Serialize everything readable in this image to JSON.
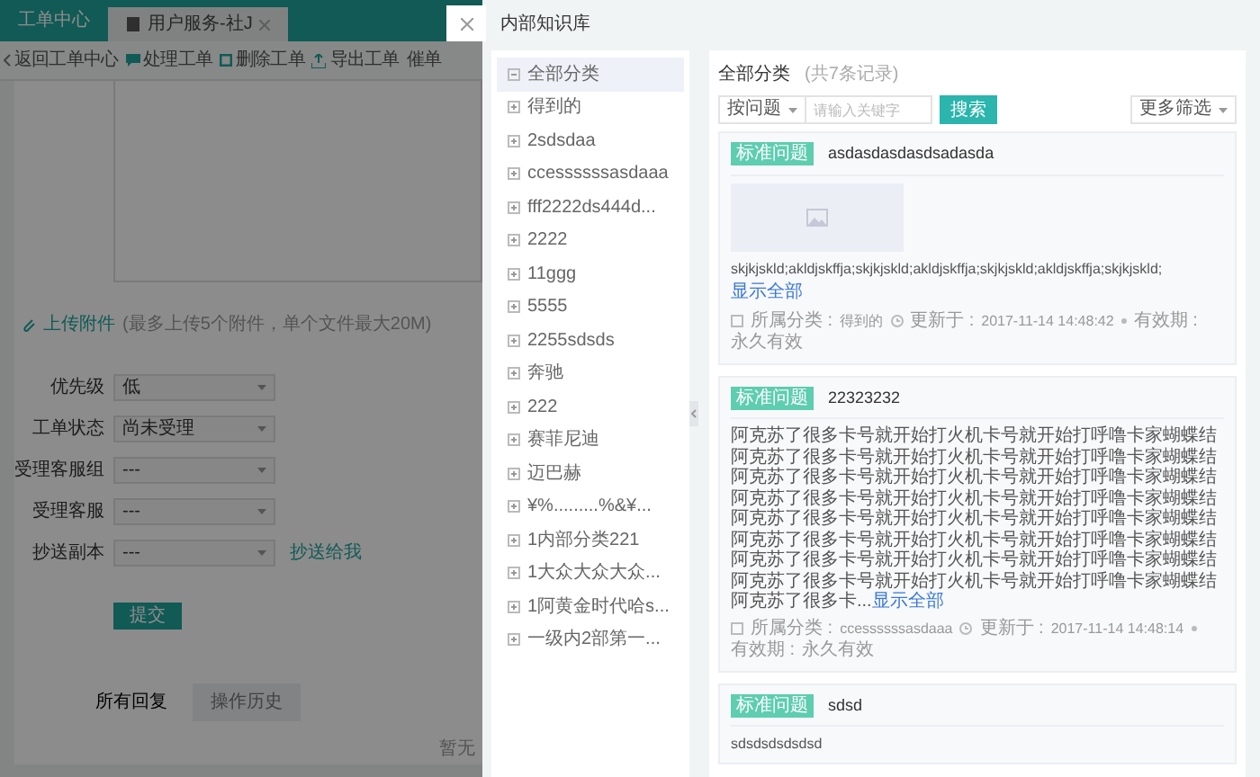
{
  "background_page": {
    "tabs": [
      {
        "label": "工单中心",
        "selected": false,
        "closable": false
      },
      {
        "label": "用户服务-社J",
        "selected": true,
        "closable": true
      }
    ],
    "toolbar": [
      {
        "label": "返回工单中心",
        "kind": "back"
      },
      {
        "label": "处理工单",
        "kind": "chat"
      },
      {
        "label": "删除工单",
        "kind": "square"
      },
      {
        "label": "导出工单",
        "kind": "export"
      },
      {
        "label": "催单",
        "kind": "plain"
      }
    ],
    "upload": {
      "link": "上传附件",
      "hint": "(最多上传5个附件，单个文件最大20M)"
    },
    "form": [
      {
        "label": "优先级",
        "value": "低"
      },
      {
        "label": "工单状态",
        "value": "尚未受理"
      },
      {
        "label": "受理客服组",
        "value": "---"
      },
      {
        "label": "受理客服",
        "value": "---"
      },
      {
        "label": "抄送副本",
        "value": "---",
        "link": "抄送给我"
      }
    ],
    "submit": "提交",
    "reply_tabs": [
      {
        "label": "所有回复",
        "selected": true
      },
      {
        "label": "操作历史",
        "selected": false
      }
    ],
    "empty_text": "暂无"
  },
  "drawer": {
    "title": "内部知识库",
    "tree": [
      {
        "label": "全部分类",
        "expanded": true,
        "selected": true
      },
      {
        "label": "得到的",
        "expanded": false,
        "selected": false
      },
      {
        "label": "2sdsdaa",
        "expanded": false,
        "selected": false
      },
      {
        "label": "ccessssssasdaaa",
        "expanded": false,
        "selected": false
      },
      {
        "label": "fff2222ds444d...",
        "expanded": false,
        "selected": false
      },
      {
        "label": "2222",
        "expanded": false,
        "selected": false
      },
      {
        "label": "11ggg",
        "expanded": false,
        "selected": false
      },
      {
        "label": "5555",
        "expanded": false,
        "selected": false
      },
      {
        "label": "2255sdsds",
        "expanded": false,
        "selected": false
      },
      {
        "label": "奔驰",
        "expanded": false,
        "selected": false
      },
      {
        "label": "222",
        "expanded": false,
        "selected": false
      },
      {
        "label": "赛菲尼迪",
        "expanded": false,
        "selected": false
      },
      {
        "label": "迈巴赫",
        "expanded": false,
        "selected": false
      },
      {
        "label": "¥%.........%&¥...",
        "expanded": false,
        "selected": false
      },
      {
        "label": "1内部分类221",
        "expanded": false,
        "selected": false
      },
      {
        "label": "1大众大众大众...",
        "expanded": false,
        "selected": false
      },
      {
        "label": "1阿黄金时代哈s...",
        "expanded": false,
        "selected": false
      },
      {
        "label": "一级内2部第一...",
        "expanded": false,
        "selected": false
      }
    ],
    "list_title": "全部分类",
    "list_count": "(共7条记录)",
    "search": {
      "filter": "按问题",
      "placeholder": "请输入关键字",
      "button": "搜索",
      "more": "更多筛选"
    },
    "cards": [
      {
        "tag": "标准问题",
        "title": "asdasdasdasdsadasda",
        "has_image": true,
        "body": "skjkjskld;akldjskffja;skjkjskld;akldjskffja;skjkjskld;akldjskffja;skjkjskld;",
        "more_link": "显示全部",
        "more_inline": false,
        "meta": {
          "category_label": "所属分类 :",
          "category": "得到的",
          "updated_label": "更新于 :",
          "updated": "2017-11-14 14:48:42",
          "valid_label": "有效期 :",
          "valid": "永久有效"
        }
      },
      {
        "tag": "标准问题",
        "title": "22323232",
        "has_image": false,
        "body": "阿克苏了很多卡号就开始打火机卡号就开始打呼噜卡家蝴蝶结阿克苏了很多卡号就开始打火机卡号就开始打呼噜卡家蝴蝶结阿克苏了很多卡号就开始打火机卡号就开始打呼噜卡家蝴蝶结阿克苏了很多卡号就开始打火机卡号就开始打呼噜卡家蝴蝶结阿克苏了很多卡号就开始打火机卡号就开始打呼噜卡家蝴蝶结阿克苏了很多卡号就开始打火机卡号就开始打呼噜卡家蝴蝶结阿克苏了很多卡号就开始打火机卡号就开始打呼噜卡家蝴蝶结阿克苏了很多卡号就开始打火机卡号就开始打呼噜卡家蝴蝶结阿克苏了很多卡...",
        "more_link": "显示全部",
        "more_inline": true,
        "meta": {
          "category_label": "所属分类 :",
          "category": "ccessssssasdaaa",
          "updated_label": "更新于 :",
          "updated": "2017-11-14 14:48:14",
          "valid_label": "有效期 :",
          "valid": "永久有效"
        }
      },
      {
        "tag": "标准问题",
        "title": "sdsd",
        "has_image": false,
        "body": "sdsdsdsdsdsd"
      }
    ]
  }
}
